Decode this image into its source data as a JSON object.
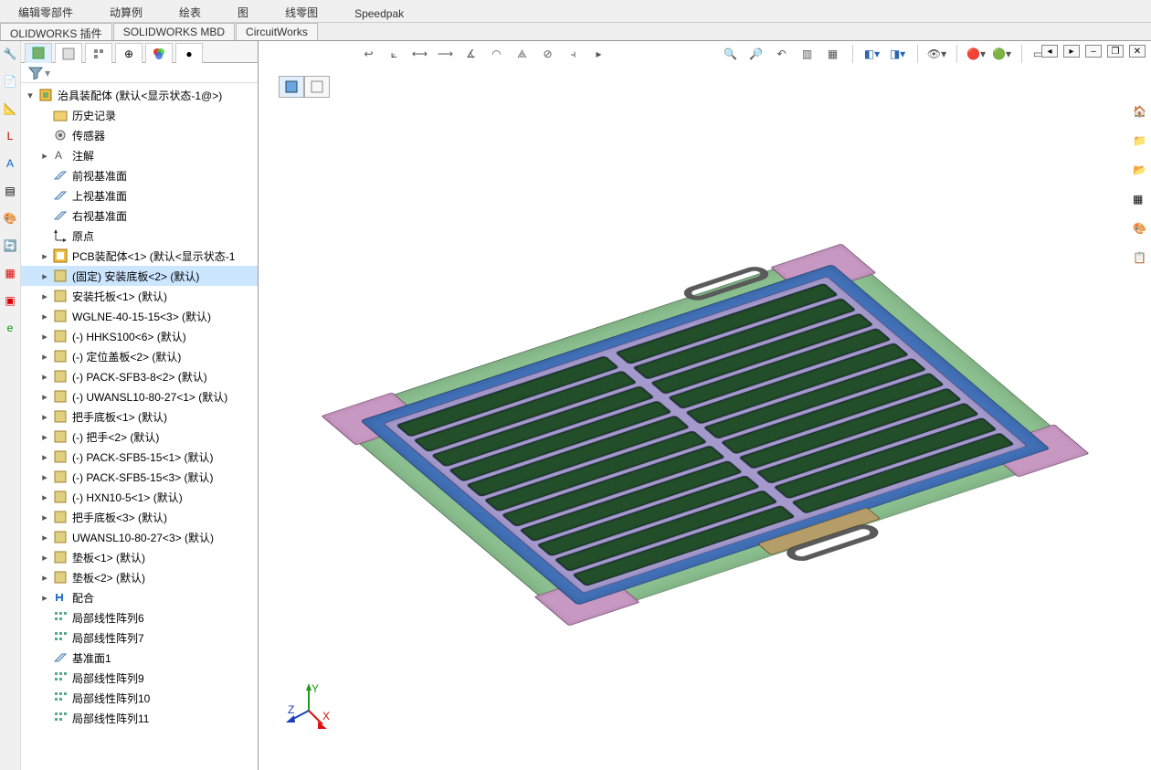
{
  "top_fragment": {
    "btn1": "编辑零部件",
    "btn2": "动算例",
    "btn3": "绘表",
    "btn4": "图",
    "btn5": "线零图",
    "btn6": "Speedpak"
  },
  "cmd_tabs": [
    "OLIDWORKS 插件",
    "SOLIDWORKS MBD",
    "CircuitWorks"
  ],
  "tree": {
    "root": "治具装配体  (默认<显示状态-1@>)",
    "items": [
      "历史记录",
      "传感器",
      "注解",
      "前视基准面",
      "上视基准面",
      "右视基准面",
      "原点",
      "PCB装配体<1>  (默认<显示状态-1",
      "(固定) 安装底板<2> (默认)",
      "安装托板<1>  (默认)",
      "WGLNE-40-15-15<3> (默认)",
      "(-) HHKS100<6>  (默认)",
      "(-) 定位盖板<2>  (默认)",
      "(-) PACK-SFB3-8<2>  (默认)",
      "(-) UWANSL10-80-27<1>  (默认)",
      "把手底板<1>  (默认)",
      "(-) 把手<2>  (默认)",
      "(-) PACK-SFB5-15<1>  (默认)",
      "(-) PACK-SFB5-15<3>  (默认)",
      "(-) HXN10-5<1>  (默认)",
      "把手底板<3>  (默认)",
      "UWANSL10-80-27<3>  (默认)",
      "垫板<1>  (默认)",
      "垫板<2>  (默认)",
      "配合",
      "局部线性阵列6",
      "局部线性阵列7",
      "基准面1",
      "局部线性阵列9",
      "局部线性阵列10",
      "局部线性阵列11"
    ],
    "selected_index": 8
  }
}
